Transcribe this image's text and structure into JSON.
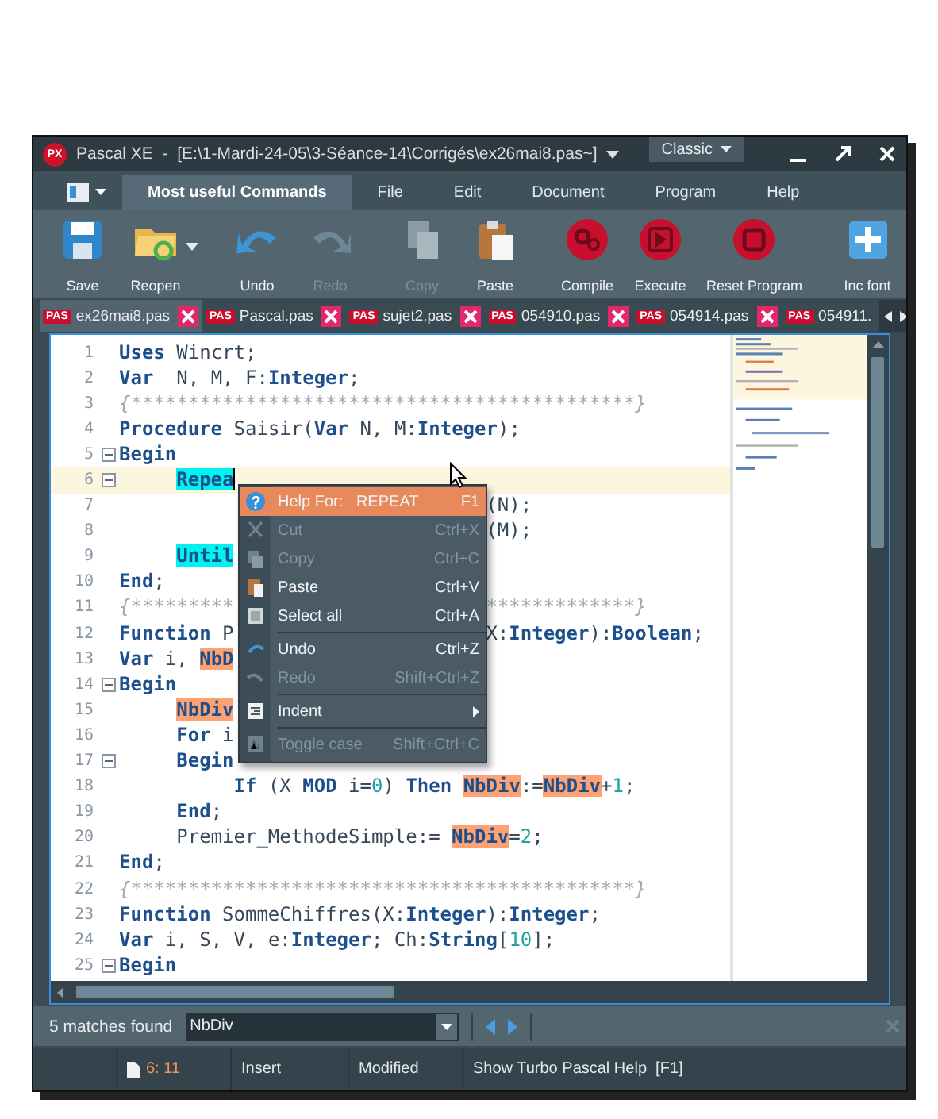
{
  "window": {
    "logo": "PX",
    "title": "Pascal XE  -  [E:\\1-Mardi-24-05\\3-Séance-14\\Corrigés\\ex26mai8.pas~]",
    "layout": "Classic"
  },
  "ribbon_tabs": [
    {
      "label": "Most useful Commands",
      "selected": true
    },
    {
      "label": "File",
      "selected": false
    },
    {
      "label": "Edit",
      "selected": false
    },
    {
      "label": "Document",
      "selected": false
    },
    {
      "label": "Program",
      "selected": false
    },
    {
      "label": "Help",
      "selected": false
    }
  ],
  "toolbar": [
    [
      {
        "label": "Save",
        "disabled": false,
        "dropdown": false
      },
      {
        "label": "Reopen",
        "disabled": false,
        "dropdown": true
      }
    ],
    [
      {
        "label": "Undo",
        "disabled": false,
        "dropdown": false
      },
      {
        "label": "Redo",
        "disabled": true,
        "dropdown": false
      }
    ],
    [
      {
        "label": "Copy",
        "disabled": true,
        "dropdown": false
      },
      {
        "label": "Paste",
        "disabled": false,
        "dropdown": false
      }
    ],
    [
      {
        "label": "Compile",
        "disabled": false,
        "dropdown": false
      },
      {
        "label": "Execute",
        "disabled": false,
        "dropdown": false
      },
      {
        "label": "Reset Program",
        "disabled": false,
        "dropdown": false
      }
    ],
    [
      {
        "label": "Inc font",
        "disabled": false,
        "dropdown": false
      }
    ]
  ],
  "file_tabs": [
    {
      "badge": "PAS",
      "name": "ex26mai8.pas",
      "selected": true,
      "closable": true
    },
    {
      "badge": "PAS",
      "name": "Pascal.pas",
      "selected": false,
      "closable": true
    },
    {
      "badge": "PAS",
      "name": "sujet2.pas",
      "selected": false,
      "closable": true
    },
    {
      "badge": "PAS",
      "name": "054910.pas",
      "selected": false,
      "closable": true
    },
    {
      "badge": "PAS",
      "name": "054914.pas",
      "selected": false,
      "closable": true
    },
    {
      "badge": "PAS",
      "name": "054911.",
      "selected": false,
      "closable": false
    }
  ],
  "code": [
    {
      "number": "1",
      "fold": false,
      "current": false,
      "left": [
        {
          "kind": "kw",
          "text": "Uses"
        },
        {
          "kind": "id",
          "text": " Wincrt;"
        }
      ]
    },
    {
      "number": "2",
      "fold": false,
      "current": false,
      "left": [
        {
          "kind": "kw",
          "text": "Var"
        },
        {
          "kind": "id",
          "text": "  N, M, F:"
        },
        {
          "kind": "kw",
          "text": "Integer"
        },
        {
          "kind": "id",
          "text": ";"
        }
      ]
    },
    {
      "number": "3",
      "fold": false,
      "current": false,
      "left": [
        {
          "kind": "cmt",
          "text": "{********************************************}"
        }
      ]
    },
    {
      "number": "4",
      "fold": false,
      "current": false,
      "left": [
        {
          "kind": "kw",
          "text": "Procedure"
        },
        {
          "kind": "id",
          "text": " Saisir("
        },
        {
          "kind": "kw",
          "text": "Var"
        },
        {
          "kind": "id",
          "text": " N, M:"
        },
        {
          "kind": "kw",
          "text": "Integer"
        },
        {
          "kind": "id",
          "text": ");"
        }
      ]
    },
    {
      "number": "5",
      "fold": true,
      "current": false,
      "left": [
        {
          "kind": "kw",
          "text": "Begin"
        }
      ]
    },
    {
      "number": "6",
      "fold": true,
      "current": true,
      "left": [
        {
          "kind": "pair",
          "text": "     Repea"
        }
      ]
    },
    {
      "number": "7",
      "fold": false,
      "current": false,
      "right": [
        {
          "kind": "id",
          "text": "(N);"
        }
      ]
    },
    {
      "number": "8",
      "fold": false,
      "current": false,
      "right": [
        {
          "kind": "id",
          "text": "(M);"
        }
      ]
    },
    {
      "number": "9",
      "fold": false,
      "current": false,
      "left": [
        {
          "kind": "pair",
          "text": "     Until"
        }
      ]
    },
    {
      "number": "10",
      "fold": false,
      "current": false,
      "left": [
        {
          "kind": "kw",
          "text": "End"
        },
        {
          "kind": "id",
          "text": ";"
        }
      ]
    },
    {
      "number": "11",
      "fold": false,
      "current": false,
      "left": [
        {
          "kind": "cmt",
          "text": "{*********"
        }
      ],
      "right": [
        {
          "kind": "cmt",
          "text": "*************}"
        }
      ]
    },
    {
      "number": "12",
      "fold": false,
      "current": false,
      "left": [
        {
          "kind": "kw",
          "text": "Function"
        },
        {
          "kind": "id",
          "text": " P"
        }
      ],
      "right": [
        {
          "kind": "id",
          "text": "X:"
        },
        {
          "kind": "kw",
          "text": "Integer"
        },
        {
          "kind": "id",
          "text": "):"
        },
        {
          "kind": "kw",
          "text": "Boolean"
        },
        {
          "kind": "id",
          "text": ";"
        }
      ]
    },
    {
      "number": "13",
      "fold": false,
      "current": false,
      "left": [
        {
          "kind": "kw",
          "text": "Var"
        },
        {
          "kind": "id",
          "text": " i, "
        },
        {
          "kind": "match",
          "text": "NbD"
        }
      ]
    },
    {
      "number": "14",
      "fold": true,
      "current": false,
      "left": [
        {
          "kind": "kw",
          "text": "Begin"
        }
      ]
    },
    {
      "number": "15",
      "fold": false,
      "current": false,
      "left": [
        {
          "kind": "match",
          "text": "     NbDiv"
        }
      ]
    },
    {
      "number": "16",
      "fold": false,
      "current": false,
      "left": [
        {
          "kind": "kw",
          "text": "     For"
        },
        {
          "kind": "id",
          "text": " i"
        }
      ]
    },
    {
      "number": "17",
      "fold": true,
      "current": false,
      "left": [
        {
          "kind": "kw",
          "text": "     Begin"
        }
      ]
    },
    {
      "number": "18",
      "fold": false,
      "current": false,
      "left": [
        {
          "kind": "kw",
          "text": "          If"
        },
        {
          "kind": "id",
          "text": " (X "
        },
        {
          "kind": "kw",
          "text": "MOD"
        },
        {
          "kind": "id",
          "text": " i="
        },
        {
          "kind": "num",
          "text": "0"
        },
        {
          "kind": "id",
          "text": ") "
        },
        {
          "kind": "kw",
          "text": "Then "
        },
        {
          "kind": "match",
          "text": "NbDiv"
        },
        {
          "kind": "id",
          "text": ":="
        },
        {
          "kind": "match",
          "text": "NbDiv"
        },
        {
          "kind": "id",
          "text": "+"
        },
        {
          "kind": "num",
          "text": "1"
        },
        {
          "kind": "id",
          "text": ";"
        }
      ]
    },
    {
      "number": "19",
      "fold": false,
      "current": false,
      "left": [
        {
          "kind": "kw",
          "text": "     End"
        },
        {
          "kind": "id",
          "text": ";"
        }
      ]
    },
    {
      "number": "20",
      "fold": false,
      "current": false,
      "left": [
        {
          "kind": "id",
          "text": "     Premier_MethodeSimple:= "
        },
        {
          "kind": "match",
          "text": "NbDiv"
        },
        {
          "kind": "id",
          "text": "="
        },
        {
          "kind": "num",
          "text": "2"
        },
        {
          "kind": "id",
          "text": ";"
        }
      ]
    },
    {
      "number": "21",
      "fold": false,
      "current": false,
      "left": [
        {
          "kind": "kw",
          "text": "End"
        },
        {
          "kind": "id",
          "text": ";"
        }
      ]
    },
    {
      "number": "22",
      "fold": false,
      "current": false,
      "left": [
        {
          "kind": "cmt",
          "text": "{********************************************}"
        }
      ]
    },
    {
      "number": "23",
      "fold": false,
      "current": false,
      "left": [
        {
          "kind": "kw",
          "text": "Function"
        },
        {
          "kind": "id",
          "text": " SommeChiffres(X:"
        },
        {
          "kind": "kw",
          "text": "Integer"
        },
        {
          "kind": "id",
          "text": "):"
        },
        {
          "kind": "kw",
          "text": "Integer"
        },
        {
          "kind": "id",
          "text": ";"
        }
      ]
    },
    {
      "number": "24",
      "fold": false,
      "current": false,
      "left": [
        {
          "kind": "kw",
          "text": "Var"
        },
        {
          "kind": "id",
          "text": " i, S, V, e:"
        },
        {
          "kind": "kw",
          "text": "Integer"
        },
        {
          "kind": "id",
          "text": "; Ch:"
        },
        {
          "kind": "kw",
          "text": "String"
        },
        {
          "kind": "id",
          "text": "["
        },
        {
          "kind": "num",
          "text": "10"
        },
        {
          "kind": "id",
          "text": "];"
        }
      ]
    },
    {
      "number": "25",
      "fold": true,
      "current": false,
      "left": [
        {
          "kind": "kw",
          "text": "Begin"
        }
      ]
    }
  ],
  "context_menu": [
    {
      "kind": "item",
      "label": "Help For:   REPEAT",
      "shortcut": "F1",
      "disabled": false,
      "selected": true
    },
    {
      "kind": "item",
      "label": "Cut",
      "shortcut": "Ctrl+X",
      "disabled": true,
      "selected": false
    },
    {
      "kind": "item",
      "label": "Copy",
      "shortcut": "Ctrl+C",
      "disabled": true,
      "selected": false
    },
    {
      "kind": "item",
      "label": "Paste",
      "shortcut": "Ctrl+V",
      "disabled": false,
      "selected": false
    },
    {
      "kind": "item",
      "label": "Select all",
      "shortcut": "Ctrl+A",
      "disabled": false,
      "selected": false
    },
    {
      "kind": "separator"
    },
    {
      "kind": "item",
      "label": "Undo",
      "shortcut": "Ctrl+Z",
      "disabled": false,
      "selected": false
    },
    {
      "kind": "item",
      "label": "Redo",
      "shortcut": "Shift+Ctrl+Z",
      "disabled": true,
      "selected": false
    },
    {
      "kind": "separator"
    },
    {
      "kind": "submenu",
      "label": "Indent",
      "disabled": false,
      "selected": false
    },
    {
      "kind": "separator"
    },
    {
      "kind": "item",
      "label": "Toggle case",
      "shortcut": "Shift+Ctrl+C",
      "disabled": true,
      "selected": false
    }
  ],
  "find_bar": {
    "result": "5 matches found",
    "value": "NbDiv"
  },
  "status_bar": {
    "position": "6: 11",
    "mode": "Insert",
    "state": "Modified",
    "hint": "Show Turbo Pascal Help  [F1]"
  }
}
